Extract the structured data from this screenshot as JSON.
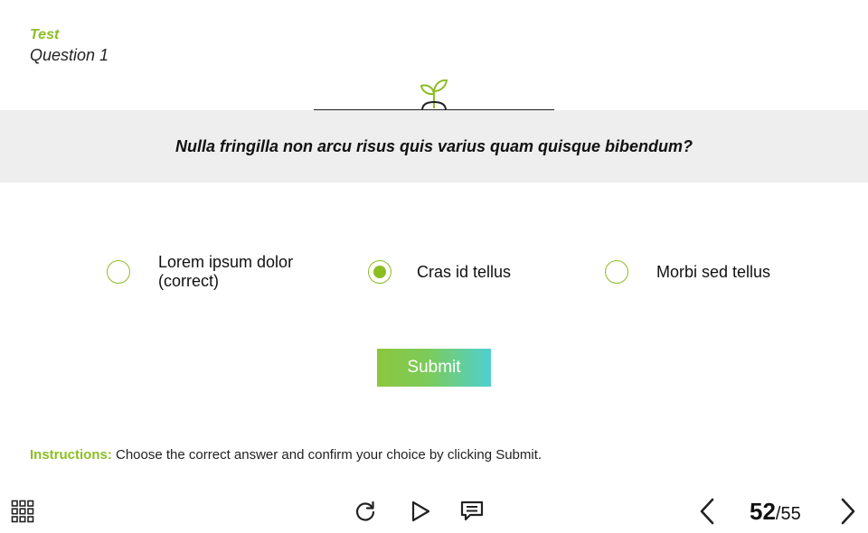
{
  "header": {
    "section": "Test",
    "title": "Question 1"
  },
  "question": {
    "text": "Nulla fringilla non arcu risus quis varius quam quisque bibendum?"
  },
  "options": [
    {
      "label": "Lorem ipsum dolor (correct)",
      "selected": false
    },
    {
      "label": "Cras id tellus",
      "selected": true
    },
    {
      "label": "Morbi sed tellus",
      "selected": false
    }
  ],
  "submit_label": "Submit",
  "instructions": {
    "label": "Instructions:",
    "text": " Choose the correct answer and confirm your choice by clicking Submit."
  },
  "footer": {
    "page_current": "52",
    "page_total": "/55",
    "icons": [
      "menu-grid-icon",
      "replay-icon",
      "play-icon",
      "comment-icon",
      "prev-arrow-icon",
      "next-arrow-icon"
    ]
  },
  "colors": {
    "accent": "#8cbe22",
    "band": "#eeeeee",
    "submit_gradient_start": "#8cc63f",
    "submit_gradient_end": "#4fd0d0"
  }
}
